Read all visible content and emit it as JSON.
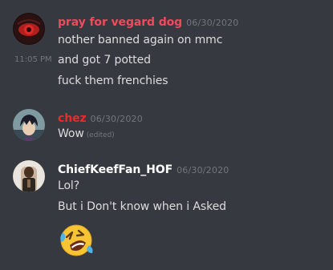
{
  "colors": {
    "background": "#36393f",
    "message_text": "#dcddde",
    "muted": "#72767d",
    "user1": "#f04a5d",
    "user2": "#ed2a2a",
    "user3": "#ffffff"
  },
  "messages": [
    {
      "username": "pray for vegard dog",
      "timestamp": "06/30/2020",
      "lines": [
        "nother banned again on mmc",
        "and got 7 potted",
        "fuck them frenchies"
      ],
      "hover_time": "11:05 PM"
    },
    {
      "username": "chez",
      "timestamp": "06/30/2020",
      "lines": [
        "Wow"
      ],
      "edited": "(edited)"
    },
    {
      "username": "ChiefKeefFan_HOF",
      "timestamp": "06/30/2020",
      "lines": [
        "Lol?",
        "But i Don't know when i Asked"
      ],
      "emoji": "rolling-on-floor-laughing-emoji"
    }
  ]
}
